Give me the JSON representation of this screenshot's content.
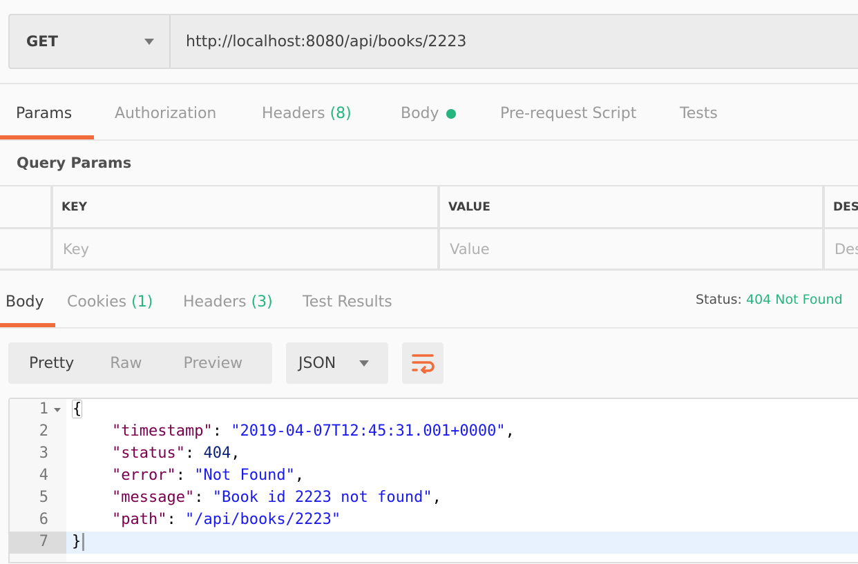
{
  "request": {
    "method": "GET",
    "url": "http://localhost:8080/api/books/2223"
  },
  "request_tabs": [
    {
      "label": "Params"
    },
    {
      "label": "Authorization"
    },
    {
      "label": "Headers",
      "count": "(8)"
    },
    {
      "label": "Body"
    },
    {
      "label": "Pre-request Script"
    },
    {
      "label": "Tests"
    }
  ],
  "query_params": {
    "title": "Query Params",
    "columns": [
      "KEY",
      "VALUE",
      "DES"
    ],
    "placeholders": [
      "Key",
      "Value",
      "Des"
    ]
  },
  "response_tabs": [
    {
      "label": "Body"
    },
    {
      "label": "Cookies",
      "count": "(1)"
    },
    {
      "label": "Headers",
      "count": "(3)"
    },
    {
      "label": "Test Results"
    }
  ],
  "status": {
    "label": "Status:",
    "value": "404 Not Found"
  },
  "view_modes": [
    "Pretty",
    "Raw",
    "Preview"
  ],
  "format": "JSON",
  "icons": {
    "wrap": "wrap-lines-icon",
    "method_dropdown": "caret-down-icon",
    "fold": "fold-caret-icon"
  },
  "colors": {
    "accent": "#f26b3a",
    "success": "#26b47f"
  },
  "code": {
    "lines": [
      "1",
      "2",
      "3",
      "4",
      "5",
      "6",
      "7"
    ],
    "open": "{",
    "close": "}",
    "entries": [
      {
        "key": "\"timestamp\"",
        "value": "\"2019-04-07T12:45:31.001+0000\"",
        "tail": ","
      },
      {
        "key": "\"status\"",
        "value": "404",
        "tail": ","
      },
      {
        "key": "\"error\"",
        "value": "\"Not Found\"",
        "tail": ","
      },
      {
        "key": "\"message\"",
        "value": "\"Book id 2223 not found\"",
        "tail": ","
      },
      {
        "key": "\"path\"",
        "value": "\"/api/books/2223\"",
        "tail": ""
      }
    ]
  }
}
